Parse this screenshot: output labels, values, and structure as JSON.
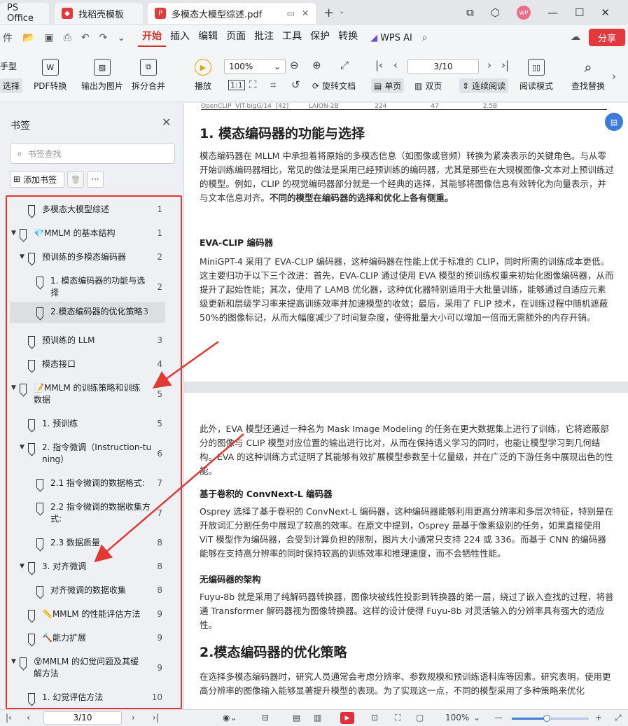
{
  "titlebar": {
    "app_tab": "PS Office",
    "tab1": "找稻壳模板",
    "tab2": "多模态大模型综述.pdf",
    "avatar": "WP"
  },
  "menubar": {
    "items": [
      "开始",
      "插入",
      "编辑",
      "页面",
      "批注",
      "工具",
      "保护",
      "转换"
    ],
    "active": "开始",
    "wps_ai": "WPS AI",
    "share": "分享"
  },
  "ribbon": {
    "hand_tool": "手型",
    "select_tool": "选择",
    "pdf_convert": "PDF转换",
    "export_image": "输出为图片",
    "split_merge": "拆分合并",
    "play": "播放",
    "zoom": "100%",
    "page_input": "3/10",
    "rotate": "旋转文档",
    "single_page": "单页",
    "double_page": "双页",
    "continuous": "连续阅读",
    "reading_mode": "阅读模式",
    "find_replace": "查找替换"
  },
  "sidebar": {
    "title": "书签",
    "search_placeholder": "书签查找",
    "add_bookmark": "添加书签",
    "more": "···",
    "items": [
      {
        "label": "多模态大模型综述",
        "page": "1"
      },
      {
        "label": "💎MMLM 的基本结构",
        "page": "1"
      },
      {
        "label": "预训练的多模态编码器",
        "page": "2"
      },
      {
        "label1": "1. 模态编码器的功能与选",
        "label2": "择",
        "page": "2"
      },
      {
        "label": "2.模态编码器的优化策略",
        "page": "3"
      },
      {
        "label": "预训练的 LLM",
        "page": "3"
      },
      {
        "label": "模态接口",
        "page": "4"
      },
      {
        "label1": "📝MMLM 的训练策略和训练",
        "label2": "数据",
        "page": "5"
      },
      {
        "label": "1. 预训练",
        "page": "5"
      },
      {
        "label1": "2. 指令微调（Instruction-tu",
        "label2": "ning）",
        "page": "6"
      },
      {
        "label": "2.1 指令微调的数据格式:",
        "page": "7"
      },
      {
        "label1": "2.2 指令微调的数据收集方",
        "label2": "式:",
        "page": "7"
      },
      {
        "label": "2.3 数据质量",
        "page": "8"
      },
      {
        "label": "3. 对齐微调",
        "page": "8"
      },
      {
        "label": "对齐微调的数据收集",
        "page": "8"
      },
      {
        "label": "📏MMLM 的性能评估方法",
        "page": "9"
      },
      {
        "label": "🔨能力扩展",
        "page": "9"
      },
      {
        "label1": "😵MMLM 的幻觉问题及其缓",
        "label2": "解方法",
        "page": "9"
      },
      {
        "label": "1. 幻觉评估方法",
        "page": "10"
      }
    ]
  },
  "document": {
    "table_fragment": "OpenCLIP  ViT-bigG/14  [42]          LAION-2B                  224                      47                      2.5B",
    "h_section1": "1. 模态编码器的功能与选择",
    "p1": "模态编码器在 MLLM 中承担着将原始的多模态信息（如图像或音频）转换为紧凑表示的关键角色。与从零开始训练编码器相比，常见的做法是采用已经预训练的编码器，尤其是那些在大规模图像-文本对上预训练过的模型。例如，CLIP 的视觉编码器部分就是一个经典的选择，其能够将图像信息有效转化为向量表示，并与文本信息对齐。",
    "p1_bold": "不同的模型在编码器的选择和优化上各有侧重。",
    "h_evaclip": "EVA-CLIP 编码器",
    "p2": "MiniGPT-4 采用了 EVA-CLIP 编码器，这种编码器在性能上优于标准的 CLIP，同时所需的训练成本更低。这主要归功于以下三个改进：首先，EVA-CLIP 通过使用 EVA 模型的预训练权重来初始化图像编码器，从而提升了起始性能；其次，使用了 LAMB 优化器，这种优化器特别适用于大批量训练，能够通过自适应元素级更新和层级学习率来提高训练效率并加速模型的收敛；最后，采用了 FLIP 技术，在训练过程中随机遮蔽 50%的图像标记，从而大幅度减少了时间复杂度，使得批量大小可以增加一倍而无需额外的内存开销。",
    "p3": "此外，EVA 模型还通过一种名为 Mask Image Modeling 的任务在更大数据集上进行了训练，它将遮蔽部分的图像与 CLIP 模型对应位置的输出进行比对，从而在保持语义学习的同时，也能让模型学习到几何结构。EVA 的这种训练方式证明了其能够有效扩展模型参数至十亿量级，并在广泛的下游任务中展现出色的性能。",
    "h_convnext": "基于卷积的 ConvNext-L 编码器",
    "p4": "Osprey 选择了基于卷积的 ConvNext-L 编码器，这种编码器能够利用更高分辨率和多层次特征，特别是在开放词汇分割任务中展现了较高的效率。在原文中提到，Osprey 是基于像素级别的任务，如果直接使用 ViT 模型作为编码器，会受到计算负担的限制，图片大小通常只支持 224 或 336。而基于 CNN 的编码器能够在支持高分辨率的同时保持较高的训练效率和推理速度，而不会牺牲性能。",
    "h_noencoder": "无编码器的架构",
    "p5": "Fuyu-8b 就是采用了纯解码器转换器，图像块被线性投影到转换器的第一层，绕过了嵌入查找的过程，将普通 Transformer 解码器视为图像转换器。这样的设计使得 Fuyu-8b 对灵活输入的分辨率具有强大的适应性。",
    "h_section2": "2.模态编码器的优化策略",
    "p6": "在选择多模态编码器时，研究人员通常会考虑分辨率、参数规模和预训练语料库等因素。研究表明，使用更高分辨率的图像输入能够显著提升模型的表现。为了实现这一点，不同的模型采用了多种策略来优化"
  },
  "statusbar": {
    "page": "3/10",
    "zoom": "100%",
    "zoom_level": 0.45
  },
  "colors": {
    "accent_red": "#d4312b",
    "highlight_frame": "#e13a34",
    "blue": "#3d7bd9"
  }
}
